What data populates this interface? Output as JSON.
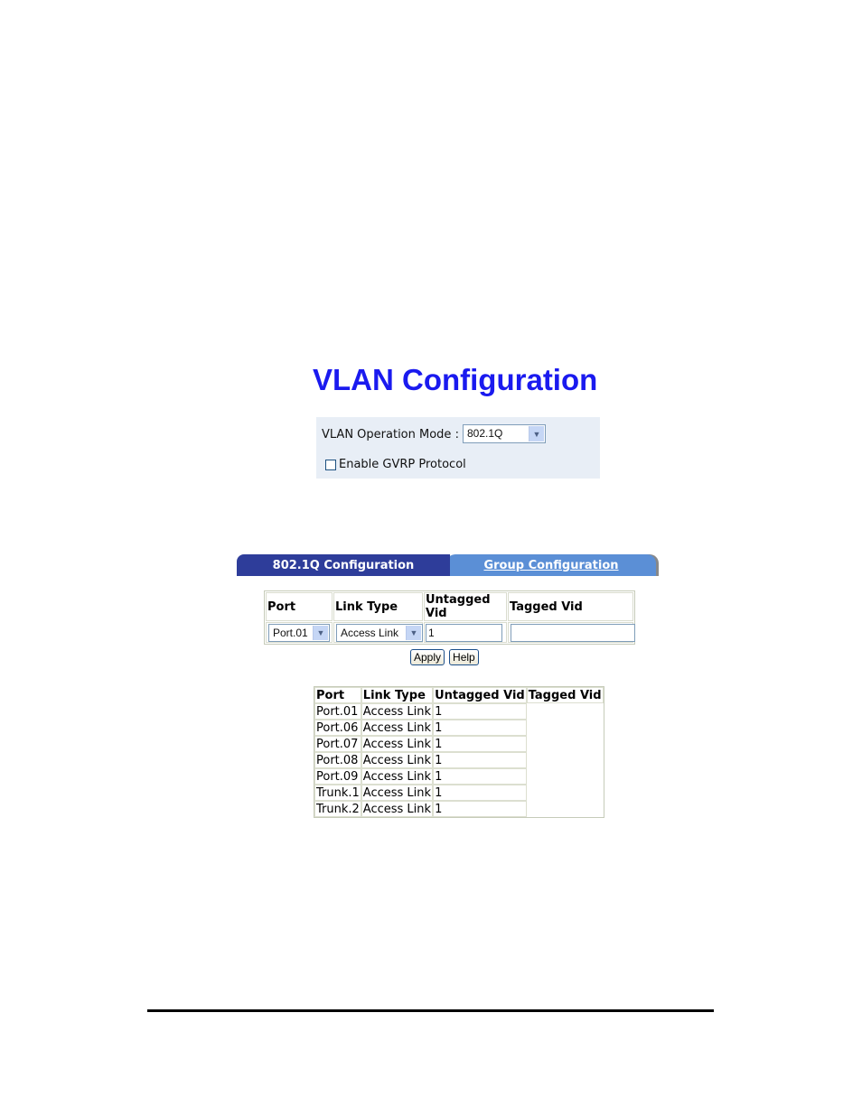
{
  "page_title": "VLAN Configuration",
  "mode": {
    "label": "VLAN Operation Mode :",
    "selected": "802.1Q",
    "gvrp_label": "Enable GVRP Protocol",
    "gvrp_checked": false
  },
  "tabs": [
    {
      "label": "802.1Q Configuration",
      "active": true
    },
    {
      "label": "Group Configuration",
      "active": false
    }
  ],
  "config_table": {
    "headers": [
      "Port",
      "Link Type",
      "Untagged Vid",
      "Tagged Vid"
    ],
    "port_selected": "Port.01",
    "link_type_selected": "Access Link",
    "untagged_vid": "1",
    "tagged_vid": ""
  },
  "buttons": {
    "apply": "Apply",
    "help": "Help"
  },
  "vlan_list": {
    "headers": [
      "Port",
      "Link Type",
      "Untagged Vid",
      "Tagged Vid"
    ],
    "rows": [
      {
        "port": "Port.01",
        "link": "Access Link",
        "untagged": "1"
      },
      {
        "port": "Port.06",
        "link": "Access Link",
        "untagged": "1"
      },
      {
        "port": "Port.07",
        "link": "Access Link",
        "untagged": "1"
      },
      {
        "port": "Port.08",
        "link": "Access Link",
        "untagged": "1"
      },
      {
        "port": "Port.09",
        "link": "Access Link",
        "untagged": "1"
      },
      {
        "port": "Trunk.1",
        "link": "Access Link",
        "untagged": "1"
      },
      {
        "port": "Trunk.2",
        "link": "Access Link",
        "untagged": "1"
      }
    ]
  }
}
